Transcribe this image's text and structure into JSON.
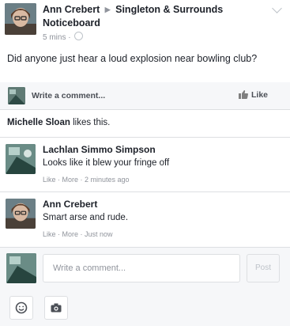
{
  "post": {
    "author": "Ann Crebert",
    "group": "Singleton & Surrounds Noticeboard",
    "time": "5 mins",
    "text": "Did anyone just hear a loud explosion near bowling club?"
  },
  "actions": {
    "write_comment": "Write a comment...",
    "like": "Like"
  },
  "likes": {
    "name": "Michelle Sloan",
    "suffix": " likes this."
  },
  "comments": [
    {
      "author": "Lachlan Simmo Simpson",
      "text": "Looks like it blew your fringe off",
      "meta": "Like · More · 2 minutes ago"
    },
    {
      "author": "Ann Crebert",
      "text": "Smart arse and rude.",
      "meta": "Like · More · Just now"
    }
  ],
  "compose": {
    "placeholder": "Write a comment...",
    "post_label": "Post"
  },
  "colors": {
    "brand_link": "#365899",
    "background": "#f6f7f9",
    "meta_text": "#90949c"
  },
  "icons": [
    "globe-icon",
    "chevron-down-icon",
    "thumbs-up-icon",
    "emoji-icon",
    "camera-icon"
  ]
}
